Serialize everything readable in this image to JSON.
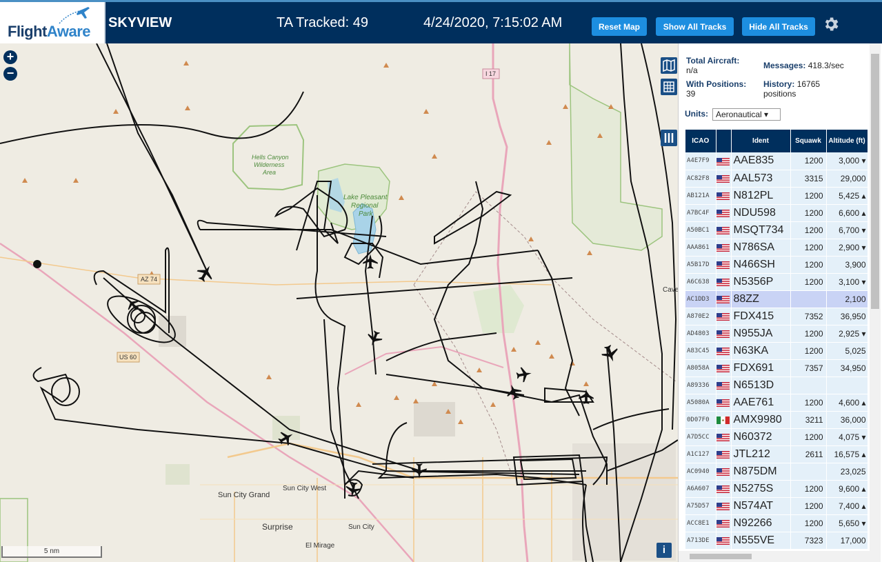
{
  "header": {
    "logo_flight": "Flight",
    "logo_aware": "Aware",
    "title": "SKYVIEW",
    "tracked": "TA Tracked: 49",
    "datetime": "4/24/2020, 7:15:02 AM",
    "reset_map": "Reset Map",
    "show_all_tracks": "Show All Tracks",
    "hide_all_tracks": "Hide All Tracks"
  },
  "map": {
    "zoom_in": "+",
    "zoom_out": "−",
    "scale": "5 nm",
    "info": "i",
    "labels": {
      "hells_canyon": "Hells Canyon",
      "wilderness": "Wilderness",
      "area": "Area",
      "lake_pleasant": "Lake Pleasant",
      "regional": "Regional",
      "park": "Park",
      "i17": "I 17",
      "az74": "AZ 74",
      "us60": "US 60",
      "sun_city_grand": "Sun City Grand",
      "sun_city_west": "Sun City West",
      "surprise": "Surprise",
      "sun_city": "Sun City",
      "el_mirage": "El Mirage",
      "cave": "Cave"
    }
  },
  "panel": {
    "total_aircraft_label": "Total Aircraft:",
    "total_aircraft_value": "n/a",
    "with_positions_label": "With Positions:",
    "with_positions_value": "39",
    "messages_label": "Messages:",
    "messages_value": "418.3/sec",
    "history_label": "History:",
    "history_value": "16765",
    "history_unit": "positions",
    "units_label": "Units:",
    "units_value": "Aeronautical ▾",
    "columns": [
      "ICAO",
      "",
      "Ident",
      "Squawk",
      "Altitude (ft)"
    ],
    "rows": [
      {
        "icao": "A4E7F9",
        "flag": "us",
        "ident": "AAE835",
        "squawk": "1200",
        "alt": "3,000 ▾"
      },
      {
        "icao": "AC82F8",
        "flag": "us",
        "ident": "AAL573",
        "squawk": "3315",
        "alt": "29,000"
      },
      {
        "icao": "AB121A",
        "flag": "us",
        "ident": "N812PL",
        "squawk": "1200",
        "alt": "5,425 ▴"
      },
      {
        "icao": "A7BC4F",
        "flag": "us",
        "ident": "NDU598",
        "squawk": "1200",
        "alt": "6,600 ▴"
      },
      {
        "icao": "A50BC1",
        "flag": "us",
        "ident": "MSQT734",
        "squawk": "1200",
        "alt": "6,700 ▾"
      },
      {
        "icao": "AAA861",
        "flag": "us",
        "ident": "N786SA",
        "squawk": "1200",
        "alt": "2,900 ▾"
      },
      {
        "icao": "A5B17D",
        "flag": "us",
        "ident": "N466SH",
        "squawk": "1200",
        "alt": "3,900"
      },
      {
        "icao": "A6C638",
        "flag": "us",
        "ident": "N5356P",
        "squawk": "1200",
        "alt": "3,100 ▾"
      },
      {
        "icao": "AC1DD3",
        "flag": "us",
        "ident": "88ZZ",
        "squawk": "",
        "alt": "2,100",
        "selected": true
      },
      {
        "icao": "A870E2",
        "flag": "us",
        "ident": "FDX415",
        "squawk": "7352",
        "alt": "36,950"
      },
      {
        "icao": "AD4803",
        "flag": "us",
        "ident": "N955JA",
        "squawk": "1200",
        "alt": "2,925 ▾"
      },
      {
        "icao": "A83C45",
        "flag": "us",
        "ident": "N63KA",
        "squawk": "1200",
        "alt": "5,025"
      },
      {
        "icao": "A8058A",
        "flag": "us",
        "ident": "FDX691",
        "squawk": "7357",
        "alt": "34,950"
      },
      {
        "icao": "A89336",
        "flag": "us",
        "ident": "N6513D",
        "squawk": "",
        "alt": ""
      },
      {
        "icao": "A5080A",
        "flag": "us",
        "ident": "AAE761",
        "squawk": "1200",
        "alt": "4,600 ▴"
      },
      {
        "icao": "0D07F0",
        "flag": "mx",
        "ident": "AMX9980",
        "squawk": "3211",
        "alt": "36,000"
      },
      {
        "icao": "A7D5CC",
        "flag": "us",
        "ident": "N60372",
        "squawk": "1200",
        "alt": "4,075 ▾"
      },
      {
        "icao": "A1C127",
        "flag": "us",
        "ident": "JTL212",
        "squawk": "2611",
        "alt": "16,575 ▴"
      },
      {
        "icao": "AC0940",
        "flag": "us",
        "ident": "N875DM",
        "squawk": "",
        "alt": "23,025"
      },
      {
        "icao": "A6A607",
        "flag": "us",
        "ident": "N5275S",
        "squawk": "1200",
        "alt": "9,600 ▴"
      },
      {
        "icao": "A75D57",
        "flag": "us",
        "ident": "N574AT",
        "squawk": "1200",
        "alt": "7,400 ▴"
      },
      {
        "icao": "ACC8E1",
        "flag": "us",
        "ident": "N92266",
        "squawk": "1200",
        "alt": "5,650 ▾"
      },
      {
        "icao": "A713DE",
        "flag": "us",
        "ident": "N555VE",
        "squawk": "7323",
        "alt": "17,000"
      }
    ]
  },
  "colors": {
    "header_bg": "#002f5d",
    "button_bg": "#1d8ee0",
    "map_bg": "#efece3",
    "row_bg": "#e4f0f9",
    "selected_row_bg": "#c9d3f5"
  }
}
